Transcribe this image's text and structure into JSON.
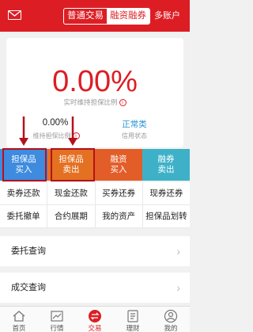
{
  "header": {
    "tabs": [
      {
        "label": "普通交易",
        "active": false
      },
      {
        "label": "融资融券",
        "active": true
      }
    ],
    "multi_account": "多账户",
    "icon": "mail-icon"
  },
  "summary": {
    "ratio_value": "0.00%",
    "ratio_label": "实时维持担保比例",
    "maintain_value": "0.00%",
    "maintain_label": "维持担保比例",
    "credit_value": "正常类",
    "credit_label": "信用状态",
    "info_glyph": "i"
  },
  "actions": {
    "colored": [
      {
        "line1": "担保品",
        "line2": "买入",
        "color": "#3e8bdf"
      },
      {
        "line1": "担保品",
        "line2": "卖出",
        "color": "#e47022"
      },
      {
        "line1": "融资",
        "line2": "买入",
        "color": "#e35d29"
      },
      {
        "line1": "融券",
        "line2": "卖出",
        "color": "#3eb1c8"
      }
    ],
    "grid_row1": [
      "卖券还款",
      "现金还款",
      "买券还券",
      "现券还券"
    ],
    "grid_row2": [
      "委托撤单",
      "合约展期",
      "我的资产",
      "担保品划转"
    ]
  },
  "list": [
    {
      "label": "委托查询"
    },
    {
      "label": "成交查询"
    }
  ],
  "tabbar": [
    {
      "label": "首页",
      "icon": "home-icon",
      "active": false
    },
    {
      "label": "行情",
      "icon": "chart-icon",
      "active": false
    },
    {
      "label": "交易",
      "icon": "trade-icon",
      "active": true
    },
    {
      "label": "理财",
      "icon": "finance-icon",
      "active": false
    },
    {
      "label": "我的",
      "icon": "user-icon",
      "active": false
    }
  ],
  "colors": {
    "brand_red": "#dc1e24",
    "credit_blue": "#2b94d6",
    "annotation_red": "#b3121c"
  }
}
